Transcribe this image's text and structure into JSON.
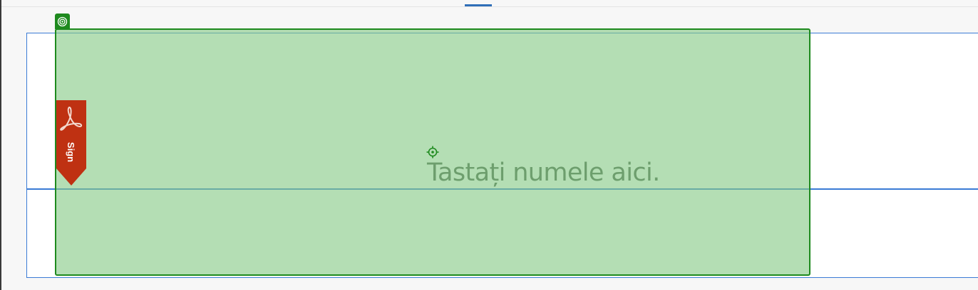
{
  "signature_field": {
    "placeholder": "Tastați numele aici.",
    "sign_tab_label": "Sign",
    "field_icon": "target-icon",
    "sign_tab_icon": "acrobat-icon",
    "position_icon": "crosshair-icon"
  },
  "colors": {
    "field_fill": "#86c986",
    "field_border": "#1e8a1e",
    "page_border": "#3a7bd5",
    "sign_tab": "#bf3112",
    "placeholder_text": "#6d9e6d"
  }
}
